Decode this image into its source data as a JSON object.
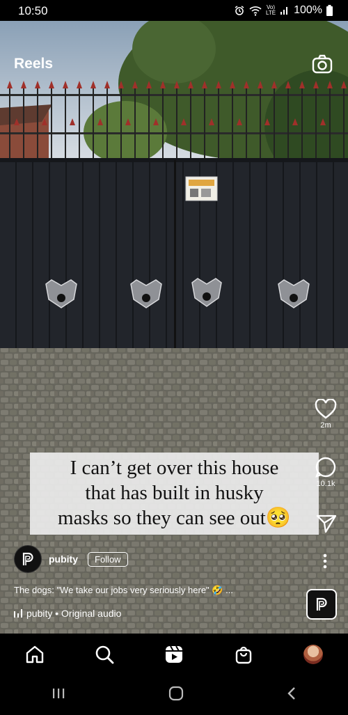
{
  "status_bar": {
    "time": "10:50",
    "network_top": "Vo)",
    "network_bottom": "LTE",
    "battery": "100%"
  },
  "header": {
    "title": "Reels"
  },
  "caption": {
    "lines": [
      "I can’t get over this house",
      "that has built in husky",
      "masks so they can see out🥺"
    ]
  },
  "actions": {
    "likes": "2m",
    "comments": "10.1k"
  },
  "post": {
    "author": "pubity",
    "follow_label": "Follow",
    "description": "The dogs: \"We take our jobs very seriously here\" 🤣 ...",
    "audio": "pubity • Original audio"
  },
  "colors": {
    "accent": "#ffffff",
    "background": "#000000",
    "gate": "#1f2228",
    "spikes": "#a0302a"
  },
  "icons": {
    "camera": "camera-icon",
    "like": "heart-icon",
    "comment": "comment-icon",
    "share": "send-icon",
    "more": "more-vertical-icon",
    "audio": "audio-bars-icon",
    "home": "home-icon",
    "search": "search-icon",
    "reels": "reels-icon",
    "shop": "shop-bag-icon",
    "profile": "profile-avatar",
    "sys_recent": "recents-icon",
    "sys_home": "home-pill-icon",
    "sys_back": "back-icon"
  }
}
